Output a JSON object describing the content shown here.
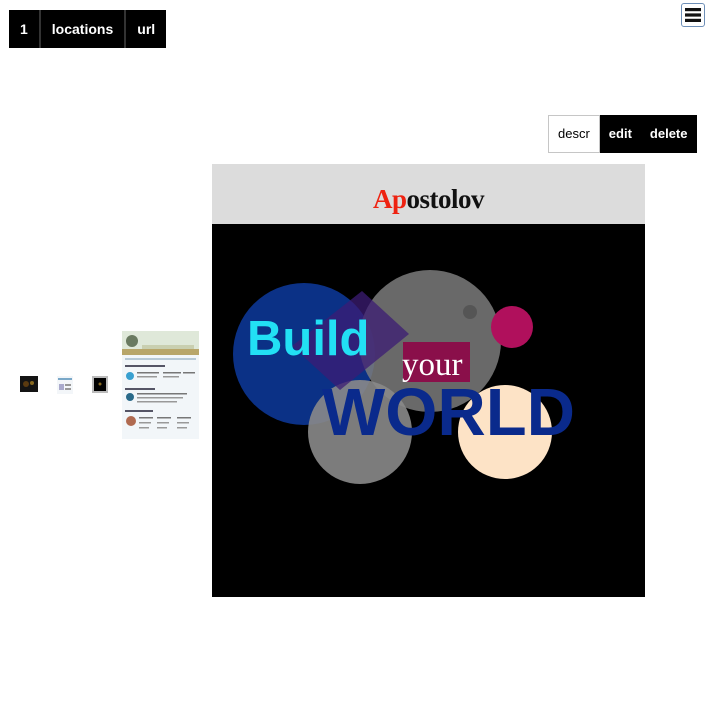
{
  "topnav": {
    "items": [
      "1",
      "locations",
      "url"
    ]
  },
  "menu": {
    "icon": "hamburger-icon"
  },
  "actions": {
    "descr": "descr",
    "edit": "edit",
    "delete": "delete"
  },
  "preview": {
    "logo_red": "Ap",
    "logo_rest": "ostolov",
    "art": {
      "line1": "Build",
      "line2": "your",
      "line3": "WORLD"
    },
    "colors": {
      "build": "#22e0f4",
      "world": "#0a2a8c",
      "your_bg": "#8a0f4a",
      "header_bg": "#dcdcdc"
    }
  },
  "thumbnails": [
    "thumbnail-dark",
    "thumbnail-light",
    "thumbnail-black",
    "thumbnail-webpage"
  ]
}
